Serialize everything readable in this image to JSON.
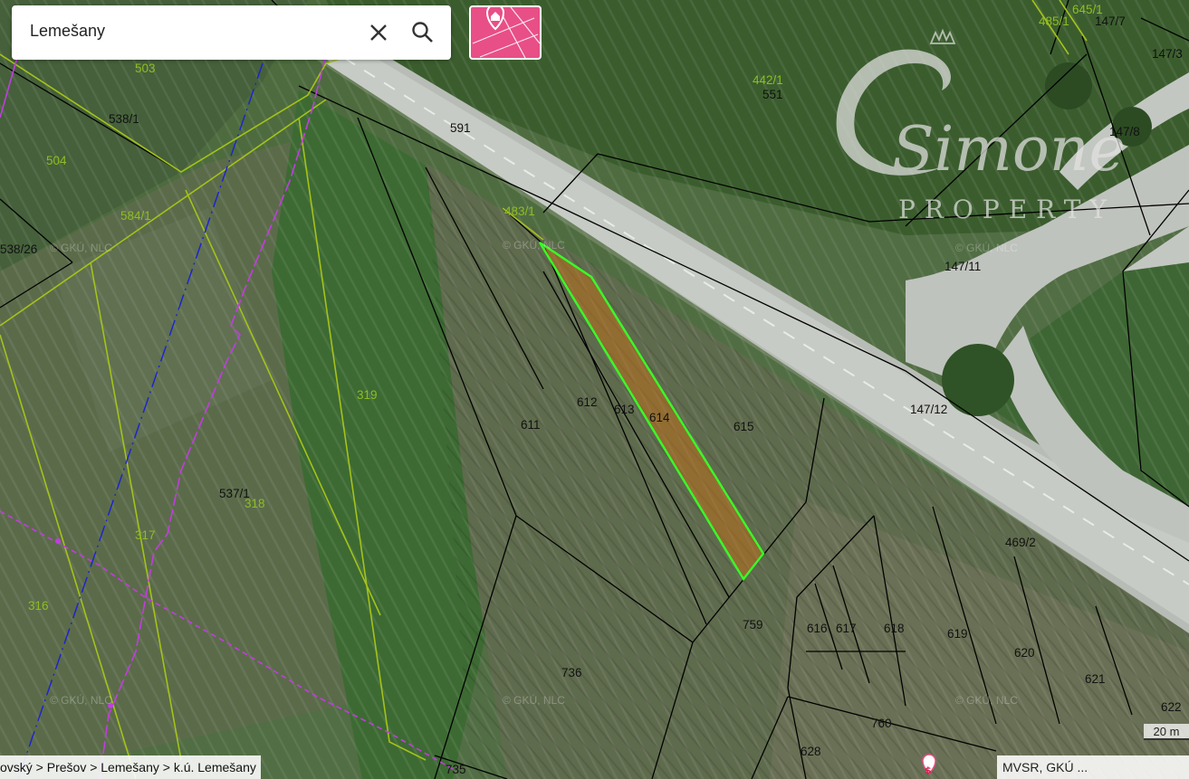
{
  "search": {
    "value": "Lemešany"
  },
  "icons": {
    "clear": "close-icon",
    "search": "search-icon",
    "layers": "map-pin-layer-icon",
    "poi": "dollar-marker-icon"
  },
  "colors": {
    "brand": "#e84f86",
    "selected_parcel": "#39ff26",
    "c_register": "#8fbd24",
    "e_register": "#000000",
    "admin_border": "#c13de0",
    "utility_line": "#1a22d6"
  },
  "breadcrumb": "ovský > Prešov > Lemešany > k.ú. Lemešany",
  "attribution": "MVSR, GKÚ ...",
  "scale": "20 m",
  "watermark": {
    "brand": "Simone",
    "sub": "PROPERTY",
    "tile": "© GKÚ, NLC"
  },
  "selected_parcel": "614",
  "parcels_black": [
    "538/1",
    "591",
    "551",
    "147/7",
    "147/3",
    "147/8",
    "147/11",
    "147/12",
    "538/26",
    "611",
    "612",
    "613",
    "615",
    "537/1",
    "469/2",
    "759",
    "616",
    "617",
    "618",
    "619",
    "620",
    "621",
    "622",
    "736",
    "760",
    "628",
    "735"
  ],
  "parcels_green": [
    "503",
    "504",
    "584/1",
    "483/1",
    "442/1",
    "485/1",
    "645/1",
    "319",
    "318",
    "317",
    "316"
  ]
}
